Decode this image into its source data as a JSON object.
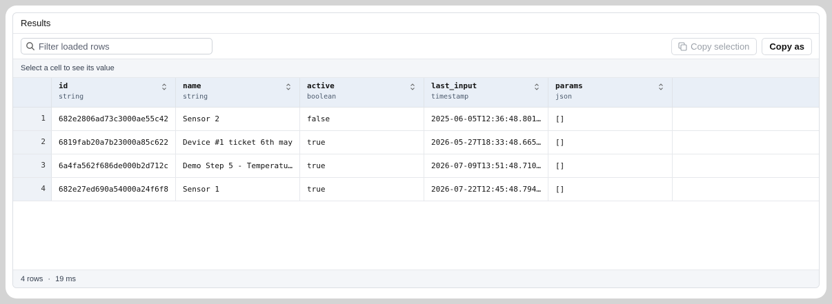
{
  "panel": {
    "title": "Results"
  },
  "toolbar": {
    "filter_placeholder": "Filter loaded rows",
    "filter_value": "",
    "copy_selection_label": "Copy selection",
    "copy_as_label": "Copy as"
  },
  "hint": "Select a cell to see its value",
  "columns": [
    {
      "name": "id",
      "type": "string"
    },
    {
      "name": "name",
      "type": "string"
    },
    {
      "name": "active",
      "type": "boolean"
    },
    {
      "name": "last_input",
      "type": "timestamp"
    },
    {
      "name": "params",
      "type": "json"
    }
  ],
  "rows": [
    {
      "index": "1",
      "cells": [
        "682e2806ad73c3000ae55c42",
        "Sensor 2",
        "false",
        "2025-06-05T12:36:48.801…",
        "[]"
      ]
    },
    {
      "index": "2",
      "cells": [
        "6819fab20a7b23000a85c622",
        "Device #1 ticket 6th may",
        "true",
        "2026-05-27T18:33:48.665…",
        "[]"
      ]
    },
    {
      "index": "3",
      "cells": [
        "6a4fa562f686de000b2d712c",
        "Demo Step 5 - Temperatu…",
        "true",
        "2026-07-09T13:51:48.710…",
        "[]"
      ]
    },
    {
      "index": "4",
      "cells": [
        "682e27ed690a54000a24f6f8",
        "Sensor 1",
        "true",
        "2026-07-22T12:45:48.794…",
        "[]"
      ]
    }
  ],
  "footer": {
    "rows_label": "4 rows",
    "separator": "·",
    "duration": "19 ms"
  },
  "icons": {
    "search": "search-icon",
    "copy": "copy-icon",
    "sort": "sort-icon"
  }
}
